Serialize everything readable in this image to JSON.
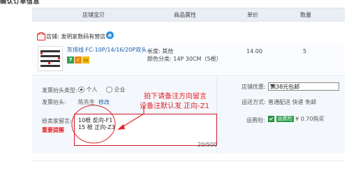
{
  "page": {
    "section_title": "确认订单信息"
  },
  "table_header": {
    "col_item": "店铺宝贝",
    "col_attr": "商品属性",
    "col_price": "单价",
    "col_qty": "数量"
  },
  "shop": {
    "name": "店铺: 发明家数码有营店"
  },
  "item": {
    "title": "灰排线 FC-10P/14/16/20P双头...",
    "badge_7": "7",
    "length": "长度: 其他",
    "color": "颜色分类: 14P 30CM（5根）",
    "price": "14.00",
    "qty": "5"
  },
  "invoice": {
    "type_label": "发票抬头类型:",
    "opt_personal": "个人",
    "opt_company": "企业",
    "header_label": "发票抬头:",
    "header_value": "陈先生",
    "modify_link": "修改"
  },
  "shop_promo": {
    "label": "店铺优惠:",
    "value": "满38元包邮"
  },
  "shipping": {
    "label": "运送方式:",
    "value": "普通配送 快递 免邮"
  },
  "freight_insurance": {
    "label": "运费险:",
    "tag": "运费险",
    "price": "¥ 0.70购买"
  },
  "message": {
    "label": "给卖家留言:",
    "reminder": "重要提醒",
    "line1": "10根 反向-F1",
    "line2": "15 根 正向-Z3",
    "counter": "20/500"
  },
  "annotation": {
    "line1": "拍下请备注方向留言",
    "line2": "设备注默认发 正向-Z1"
  },
  "colors": {
    "accent_red": "#e2232a",
    "link_blue": "#2060a8",
    "header_bg": "#e9eef4"
  }
}
